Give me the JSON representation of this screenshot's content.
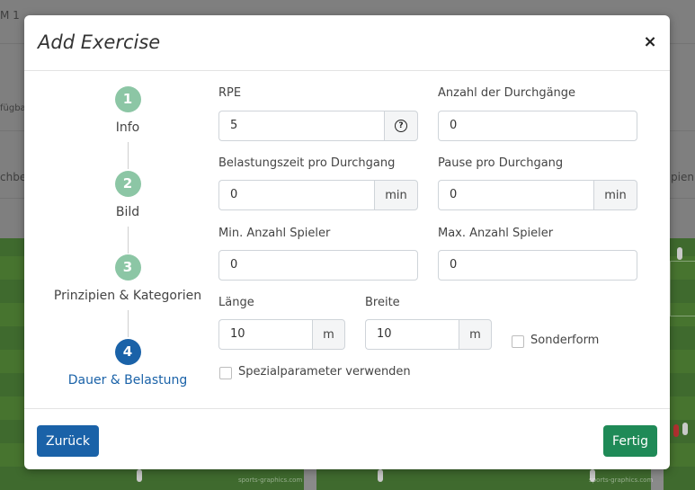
{
  "background": {
    "fragment_m1": "M 1",
    "fragment_verfuegbar": "fügba",
    "fragment_uchbe": "chbe",
    "fragment_pien": "pien",
    "watermark": "sports-graphics.com"
  },
  "modal": {
    "title": "Add Exercise",
    "close_label": "×"
  },
  "steps": [
    {
      "number": "1",
      "label": "Info",
      "active": false
    },
    {
      "number": "2",
      "label": "Bild",
      "active": false
    },
    {
      "number": "3",
      "label": "Prinzipien & Kategorien",
      "active": false
    },
    {
      "number": "4",
      "label": "Dauer & Belastung",
      "active": true
    }
  ],
  "form": {
    "rpe": {
      "label": "RPE",
      "value": "5"
    },
    "durchgaenge": {
      "label": "Anzahl der Durchgänge",
      "value": "0"
    },
    "belastungszeit": {
      "label": "Belastungszeit pro Durchgang",
      "value": "0",
      "unit": "min"
    },
    "pause": {
      "label": "Pause pro Durchgang",
      "value": "0",
      "unit": "min"
    },
    "min_spieler": {
      "label": "Min. Anzahl Spieler",
      "value": "0"
    },
    "max_spieler": {
      "label": "Max. Anzahl Spieler",
      "value": "0"
    },
    "laenge": {
      "label": "Länge",
      "value": "10",
      "unit": "m"
    },
    "breite": {
      "label": "Breite",
      "value": "10",
      "unit": "m"
    },
    "sonderform": {
      "label": "Sonderform",
      "checked": false
    },
    "spezialparameter": {
      "label": "Spezialparameter verwenden",
      "checked": false
    }
  },
  "footer": {
    "back_label": "Zurück",
    "done_label": "Fertig"
  },
  "colors": {
    "primary": "#1a62a8",
    "success": "#1f8a57",
    "step_inactive": "#8cc6a5"
  }
}
